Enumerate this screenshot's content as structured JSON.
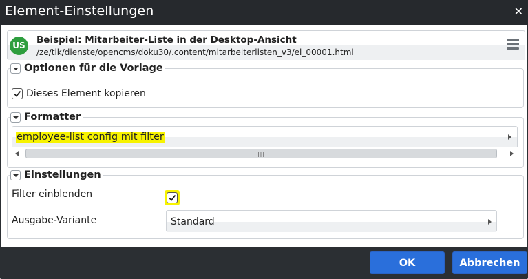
{
  "dialog": {
    "title": "Element-Einstellungen",
    "close_icon": "close-icon"
  },
  "resource": {
    "badge": "US",
    "title": "Beispiel: Mitarbeiter-Liste in der Desktop-Ansicht",
    "path": "/ze/tik/dienste/opencms/doku30/.content/mitarbeiterlisten_v3/el_00001.html",
    "menu_icon": "menu-icon"
  },
  "template_options": {
    "legend": "Optionen für die Vorlage",
    "copy_element": {
      "label": "Dieses Element kopieren",
      "checked": true
    }
  },
  "formatter": {
    "legend": "Formatter",
    "selected": "employee-list config mit filter"
  },
  "settings": {
    "legend": "Einstellungen",
    "show_filter": {
      "label": "Filter einblenden",
      "checked": true
    },
    "output_variant": {
      "label": "Ausgabe-Variante",
      "selected": "Standard"
    }
  },
  "buttons": {
    "ok": "OK",
    "cancel": "Abbrechen"
  },
  "colors": {
    "titlebar": "#26292d",
    "button": "#2a6fdb",
    "badge": "#2e9e3e",
    "highlight": "#f7f300"
  }
}
